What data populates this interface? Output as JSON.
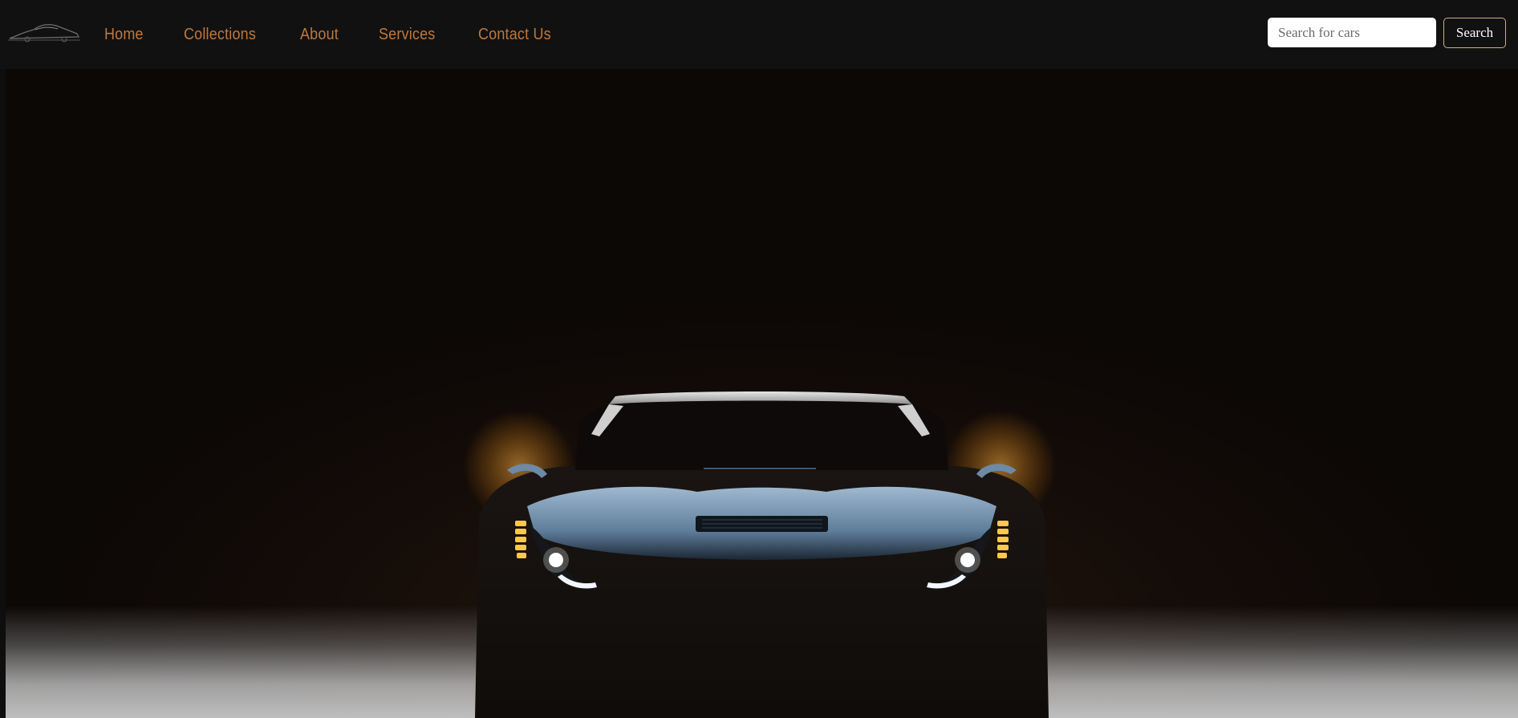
{
  "nav": {
    "links": [
      {
        "label": "Home"
      },
      {
        "label": "Collections"
      },
      {
        "label": "About"
      },
      {
        "label": "Services"
      },
      {
        "label": "Contact Us"
      }
    ]
  },
  "search": {
    "placeholder": "Search for cars",
    "value": "",
    "button_label": "Search"
  },
  "colors": {
    "nav_background": "#111111",
    "nav_link": "#c0773a",
    "search_button_border": "#c9b08a"
  },
  "icons": {
    "logo": "car-silhouette-logo"
  },
  "hero": {
    "image": "sports-car-front-headlights"
  }
}
